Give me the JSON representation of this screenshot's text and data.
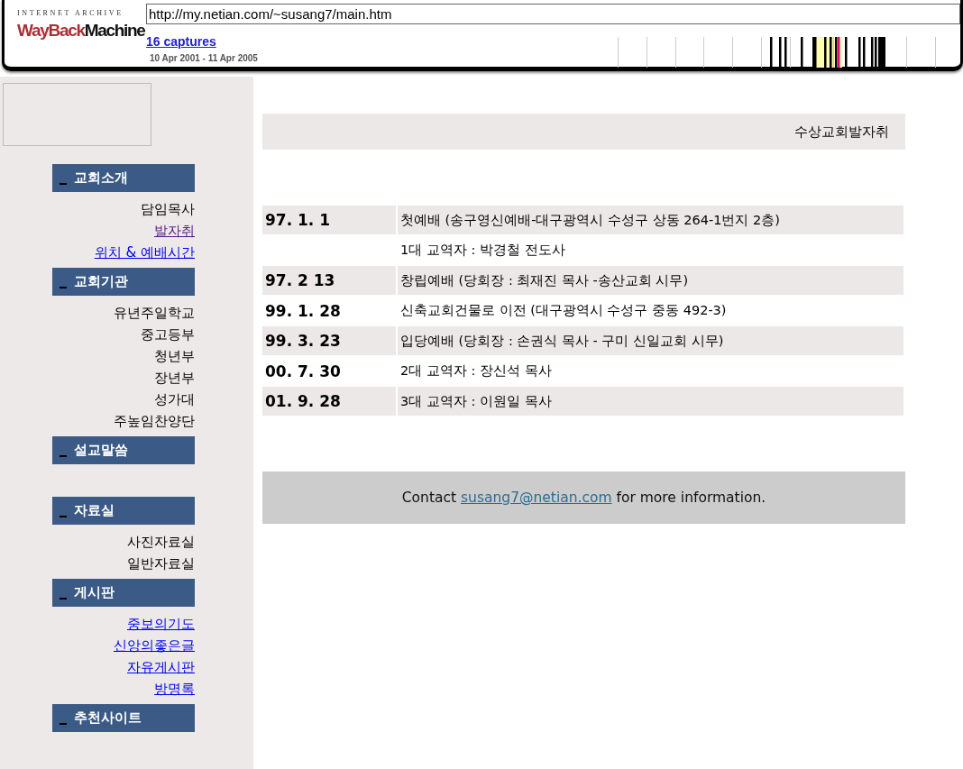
{
  "wayback": {
    "logo_top": "INTERNET ARCHIVE",
    "logo_left": "WayBack",
    "logo_right": "Machine",
    "url": "http://my.netian.com/~susang7/main.htm",
    "captures": "16 captures",
    "date_range": "10 Apr 2001 - 11 Apr 2005"
  },
  "sidebar": {
    "sections": [
      {
        "title": "교회소개",
        "items": [
          {
            "label": "담임목사",
            "kind": "text"
          },
          {
            "label": "발자취",
            "kind": "visited"
          },
          {
            "label": "위치 & 예배시간",
            "kind": "link"
          }
        ]
      },
      {
        "title": "교회기관",
        "items": [
          {
            "label": "유년주일학교",
            "kind": "text"
          },
          {
            "label": "중고등부",
            "kind": "text"
          },
          {
            "label": "청년부",
            "kind": "text"
          },
          {
            "label": "장년부",
            "kind": "text"
          },
          {
            "label": "성가대",
            "kind": "text"
          },
          {
            "label": "주높임찬양단",
            "kind": "text"
          }
        ]
      },
      {
        "title": "설교말씀"
      },
      {
        "title": "자료실",
        "items": [
          {
            "label": "사진자료실",
            "kind": "text"
          },
          {
            "label": "일반자료실",
            "kind": "text"
          }
        ]
      },
      {
        "title": "게시판",
        "items": [
          {
            "label": "중보의기도",
            "kind": "link"
          },
          {
            "label": "신앙의좋은글",
            "kind": "link"
          },
          {
            "label": "자유게시판",
            "kind": "link"
          },
          {
            "label": "방명록",
            "kind": "link"
          }
        ]
      },
      {
        "title": "추천사이트"
      }
    ]
  },
  "page_title": "수상교회발자취",
  "history": [
    {
      "date": "97. 1. 1",
      "event": "첫예배 (송구영신예배-대구광역시 수성구 상동 264-1번지 2층)",
      "shaded": true
    },
    {
      "event": "1대 교역자 : 박경철 전도사",
      "shaded": false
    },
    {
      "date": "97. 2 13",
      "event": "창립예배 (당회장 : 최재진 목사 -송산교회 시무)",
      "shaded": true
    },
    {
      "date": "99. 1. 28",
      "event": "신축교회건물로 이전 (대구광역시 수성구 중동 492-3)",
      "shaded": false
    },
    {
      "date": "99. 3. 23",
      "event": "입당예배 (당회장 : 손권식 목사 - 구미 신일교회 시무)",
      "shaded": true
    },
    {
      "date": "00. 7. 30",
      "event": "2대 교역자 : 장신석 목사",
      "shaded": false
    },
    {
      "date": "01. 9. 28",
      "event": "3대 교역자 : 이원일 목사",
      "shaded": true
    }
  ],
  "contact": {
    "before": "Contact",
    "email": "susang7@netian.com",
    "after": "for more information."
  }
}
